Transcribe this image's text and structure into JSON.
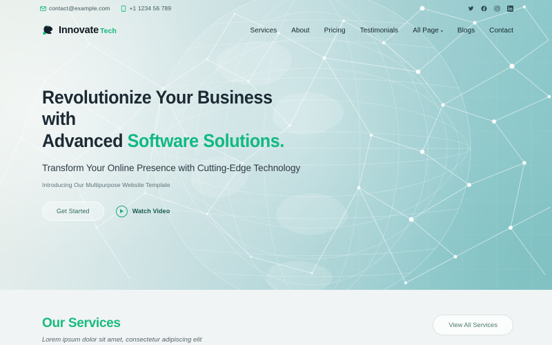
{
  "topbar": {
    "email": "contact@example.com",
    "phone": "+1 1234 56 789",
    "email_icon": "envelope-icon",
    "phone_icon": "phone-icon",
    "social": [
      {
        "name": "twitter-icon",
        "label": "Twitter"
      },
      {
        "name": "facebook-icon",
        "label": "Facebook"
      },
      {
        "name": "instagram-icon",
        "label": "Instagram"
      },
      {
        "name": "linkedin-icon",
        "label": "LinkedIn"
      }
    ]
  },
  "brand": {
    "name": "Innovate",
    "suffix": "Tech",
    "logo_icon": "abstract-leaf-logo-icon"
  },
  "nav": {
    "items": [
      {
        "label": "Services",
        "has_dropdown": false
      },
      {
        "label": "About",
        "has_dropdown": false
      },
      {
        "label": "Pricing",
        "has_dropdown": false
      },
      {
        "label": "Testimonials",
        "has_dropdown": false
      },
      {
        "label": "All Page",
        "has_dropdown": true
      },
      {
        "label": "Blogs",
        "has_dropdown": false
      },
      {
        "label": "Contact",
        "has_dropdown": false
      }
    ],
    "caret_glyph": "▾"
  },
  "hero": {
    "heading_line1": "Revolutionize Your Business with",
    "heading_line2_plain": "Advanced ",
    "heading_line2_accent": "Software Solutions.",
    "subheading": "Transform Your Online Presence with Cutting-Edge Technology",
    "kicker": "Introducing Our Multipurpose Website Template",
    "primary_cta": "Get Started",
    "video_cta": "Watch Video",
    "play_icon": "play-circle-icon"
  },
  "services": {
    "title": "Our Services",
    "subtitle": "Lorem ipsum dolor sit amet, consectetur adipiscing elit",
    "view_all": "View All Services"
  },
  "colors": {
    "accent_green": "#16b97d",
    "heading_dark": "#1c2a33",
    "hero_gradient_start": "#e7efe9",
    "hero_gradient_end": "#86c5c7",
    "services_bg": "#f0f4f4"
  }
}
